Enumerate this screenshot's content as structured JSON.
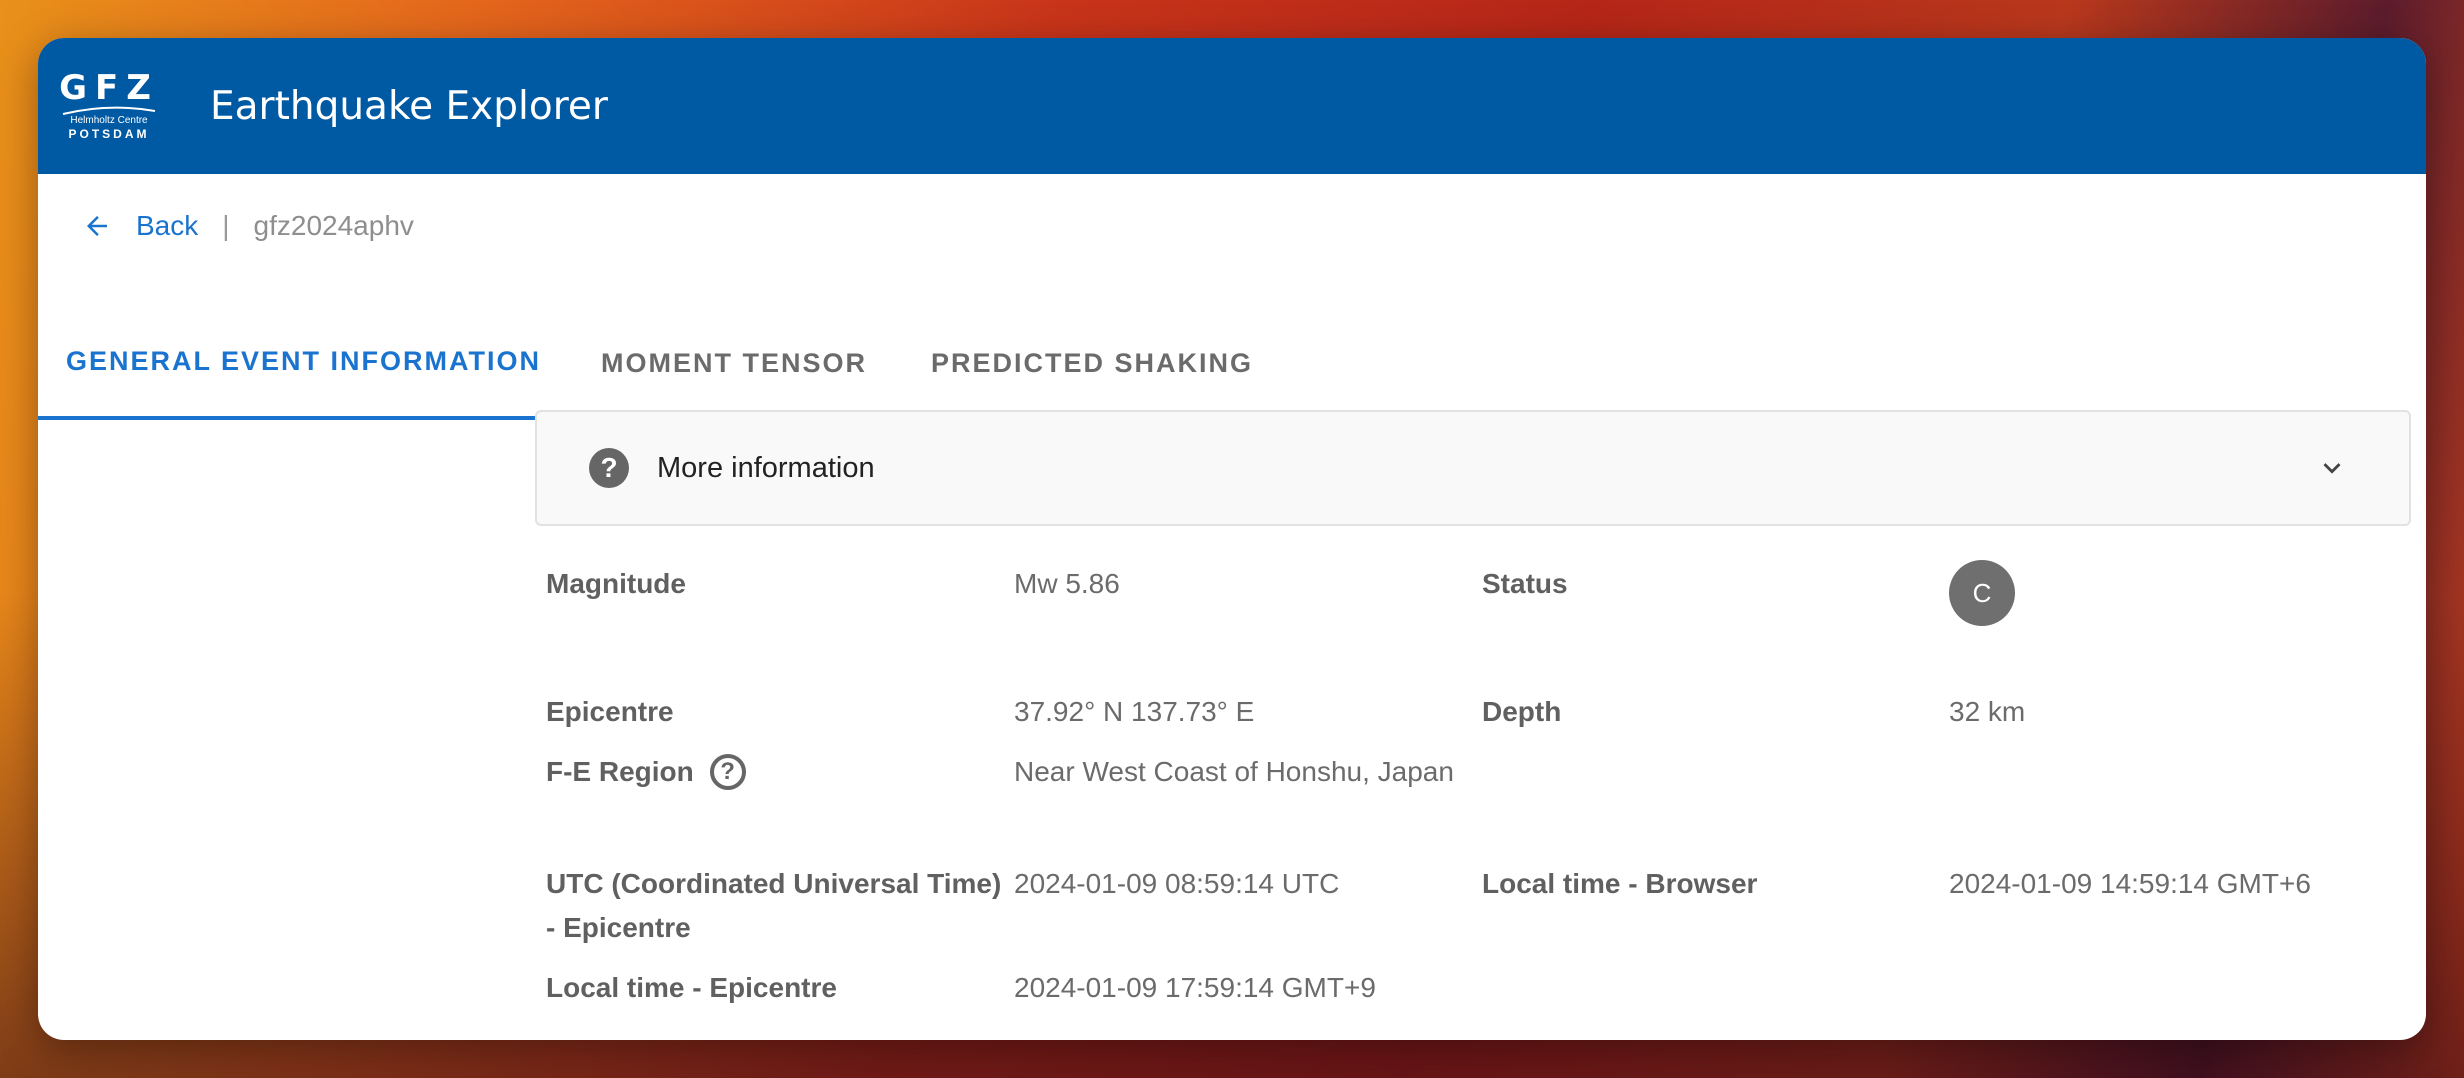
{
  "app": {
    "logo": {
      "main": "GFZ",
      "sub": "Helmholtz Centre",
      "city": "POTSDAM"
    },
    "title": "Earthquake Explorer"
  },
  "breadcrumb": {
    "back": "Back",
    "separator": "|",
    "event_id": "gfz2024aphv"
  },
  "tabs": [
    {
      "label": "GENERAL EVENT INFORMATION",
      "active": true
    },
    {
      "label": "MOMENT TENSOR",
      "active": false
    },
    {
      "label": "PREDICTED SHAKING",
      "active": false
    }
  ],
  "more_info": {
    "label": "More information"
  },
  "fields": {
    "magnitude": {
      "label": "Magnitude",
      "value": "Mw 5.86"
    },
    "status": {
      "label": "Status",
      "badge": "C"
    },
    "epicentre": {
      "label": "Epicentre",
      "value": "37.92° N 137.73° E"
    },
    "depth": {
      "label": "Depth",
      "value": "32 km"
    },
    "fe_region": {
      "label": "F-E Region",
      "value": "Near West Coast of Honshu, Japan"
    },
    "utc_epicentre": {
      "label_line1": "UTC (Coordinated Universal Time)",
      "label_line2": "- Epicentre",
      "value": "2024-01-09 08:59:14 UTC"
    },
    "local_browser": {
      "label": "Local time - Browser",
      "value": "2024-01-09 14:59:14 GMT+6"
    },
    "local_epicentre": {
      "label": "Local time - Epicentre",
      "value": "2024-01-09 17:59:14 GMT+9"
    }
  },
  "colors": {
    "brand": "#0059a3",
    "accent": "#1a73cf",
    "badge": "#6f6f6f"
  },
  "icons": [
    "back-arrow-icon",
    "help-icon",
    "chevron-down-icon",
    "help-outline-icon"
  ]
}
